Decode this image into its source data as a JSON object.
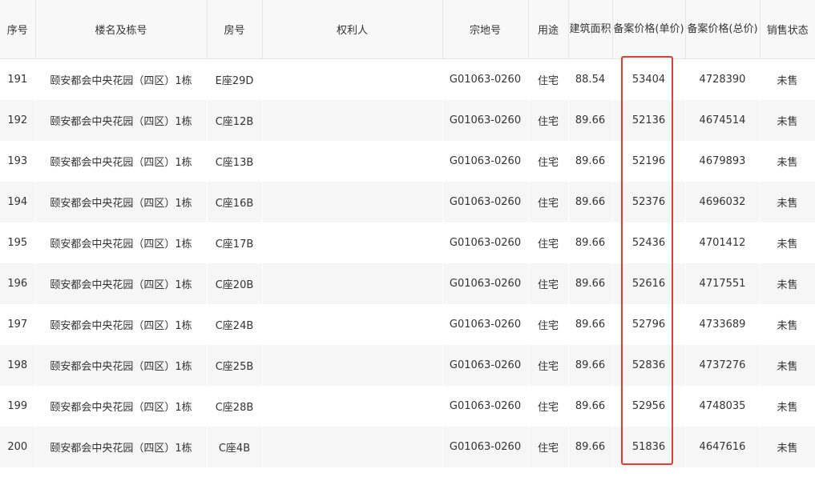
{
  "table": {
    "headers": [
      "序号",
      "楼名及栋号",
      "房号",
      "权利人",
      "宗地号",
      "用途",
      "建筑面积",
      "备案价格(单价)",
      "备案价格(总价)",
      "销售状态"
    ],
    "rows": [
      [
        "191",
        "颐安都会中央花园（四区）1栋",
        "E座29D",
        "",
        "G01063-0260",
        "住宅",
        "88.54",
        "53404",
        "4728390",
        "未售"
      ],
      [
        "192",
        "颐安都会中央花园（四区）1栋",
        "C座12B",
        "",
        "G01063-0260",
        "住宅",
        "89.66",
        "52136",
        "4674514",
        "未售"
      ],
      [
        "193",
        "颐安都会中央花园（四区）1栋",
        "C座13B",
        "",
        "G01063-0260",
        "住宅",
        "89.66",
        "52196",
        "4679893",
        "未售"
      ],
      [
        "194",
        "颐安都会中央花园（四区）1栋",
        "C座16B",
        "",
        "G01063-0260",
        "住宅",
        "89.66",
        "52376",
        "4696032",
        "未售"
      ],
      [
        "195",
        "颐安都会中央花园（四区）1栋",
        "C座17B",
        "",
        "G01063-0260",
        "住宅",
        "89.66",
        "52436",
        "4701412",
        "未售"
      ],
      [
        "196",
        "颐安都会中央花园（四区）1栋",
        "C座20B",
        "",
        "G01063-0260",
        "住宅",
        "89.66",
        "52616",
        "4717551",
        "未售"
      ],
      [
        "197",
        "颐安都会中央花园（四区）1栋",
        "C座24B",
        "",
        "G01063-0260",
        "住宅",
        "89.66",
        "52796",
        "4733689",
        "未售"
      ],
      [
        "198",
        "颐安都会中央花园（四区）1栋",
        "C座25B",
        "",
        "G01063-0260",
        "住宅",
        "89.66",
        "52836",
        "4737276",
        "未售"
      ],
      [
        "199",
        "颐安都会中央花园（四区）1栋",
        "C座28B",
        "",
        "G01063-0260",
        "住宅",
        "89.66",
        "52956",
        "4748035",
        "未售"
      ],
      [
        "200",
        "颐安都会中央花园（四区）1栋",
        "C座4B",
        "",
        "G01063-0260",
        "住宅",
        "89.66",
        "51836",
        "4647616",
        "未售"
      ]
    ]
  },
  "colors": {
    "highlight": "#e53c2f",
    "header_bg": "#f8f8f8",
    "stripe_bg": "#f6f6f6"
  }
}
